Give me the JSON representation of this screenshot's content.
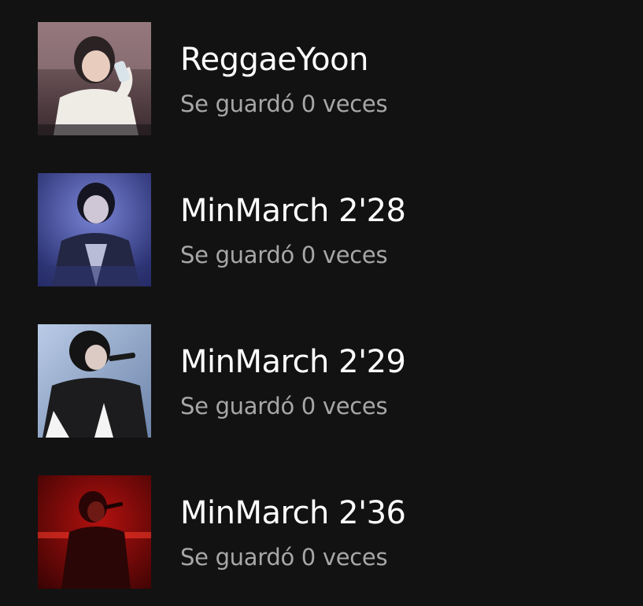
{
  "playlists": [
    {
      "title": "ReggaeYoon",
      "subtitle": "Se guardó 0 veces",
      "cover_icon": "person-photo-icon"
    },
    {
      "title": "MinMarch 2'28",
      "subtitle": "Se guardó 0 veces",
      "cover_icon": "person-photo-icon"
    },
    {
      "title": "MinMarch 2'29",
      "subtitle": "Se guardó 0 veces",
      "cover_icon": "person-photo-icon"
    },
    {
      "title": "MinMarch 2'36",
      "subtitle": "Se guardó 0 veces",
      "cover_icon": "person-photo-icon"
    }
  ],
  "colors": {
    "background": "#121212",
    "title": "#ffffff",
    "subtitle": "#a7a7a7"
  }
}
